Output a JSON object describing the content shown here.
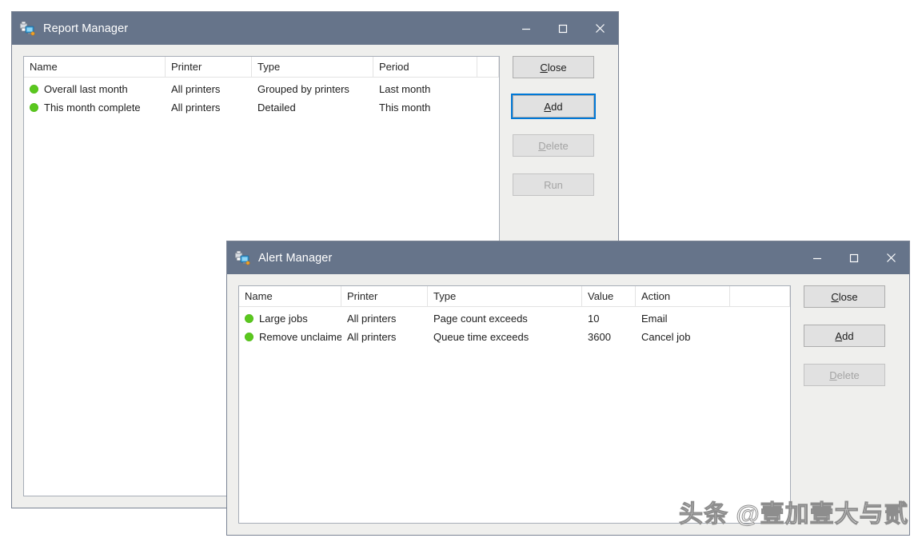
{
  "colors": {
    "titlebar": "#66748a",
    "client": "#efefed",
    "status_dot_green": "#5ac81e",
    "focus_blue": "#0078d7",
    "window_border": "#7b8494"
  },
  "windows": [
    {
      "id": "report-manager",
      "title": "Report Manager",
      "icon": "printer-network-icon",
      "titlebar_buttons": [
        {
          "name": "minimize-button",
          "glyph": "minimize-icon"
        },
        {
          "name": "maximize-button",
          "glyph": "maximize-icon"
        },
        {
          "name": "close-button",
          "glyph": "close-icon"
        }
      ],
      "table": {
        "columns": [
          "Name",
          "Printer",
          "Type",
          "Period",
          ""
        ],
        "rows": [
          {
            "status": "green",
            "name": "Overall last month",
            "printer": "All printers",
            "type": "Grouped by printers",
            "period": "Last month"
          },
          {
            "status": "green",
            "name": "This month complete",
            "printer": "All printers",
            "type": "Detailed",
            "period": "This month"
          }
        ]
      },
      "buttons": [
        {
          "name": "close-button",
          "label": "Close",
          "accel": "C",
          "state": "enabled"
        },
        {
          "name": "add-button",
          "label": "Add",
          "accel": "A",
          "state": "focused"
        },
        {
          "name": "delete-button",
          "label": "Delete",
          "accel": "D",
          "state": "disabled"
        },
        {
          "name": "run-button",
          "label": "Run",
          "accel": "",
          "state": "disabled"
        }
      ]
    },
    {
      "id": "alert-manager",
      "title": "Alert Manager",
      "icon": "printer-network-icon",
      "titlebar_buttons": [
        {
          "name": "minimize-button",
          "glyph": "minimize-icon"
        },
        {
          "name": "maximize-button",
          "glyph": "maximize-icon"
        },
        {
          "name": "close-button",
          "glyph": "close-icon"
        }
      ],
      "table": {
        "columns": [
          "Name",
          "Printer",
          "Type",
          "Value",
          "Action",
          ""
        ],
        "rows": [
          {
            "status": "green",
            "name": "Large jobs",
            "printer": "All printers",
            "type": "Page count exceeds",
            "value": "10",
            "action": "Email"
          },
          {
            "status": "green",
            "name": "Remove unclaimed",
            "printer": "All printers",
            "type": "Queue time exceeds",
            "value": "3600",
            "action": "Cancel job"
          }
        ]
      },
      "buttons": [
        {
          "name": "close-button",
          "label": "Close",
          "accel": "C",
          "state": "enabled"
        },
        {
          "name": "add-button",
          "label": "Add",
          "accel": "A",
          "state": "enabled"
        },
        {
          "name": "delete-button",
          "label": "Delete",
          "accel": "D",
          "state": "disabled"
        }
      ]
    }
  ],
  "watermark": {
    "text": "头条 @壹加壹大与贰"
  }
}
